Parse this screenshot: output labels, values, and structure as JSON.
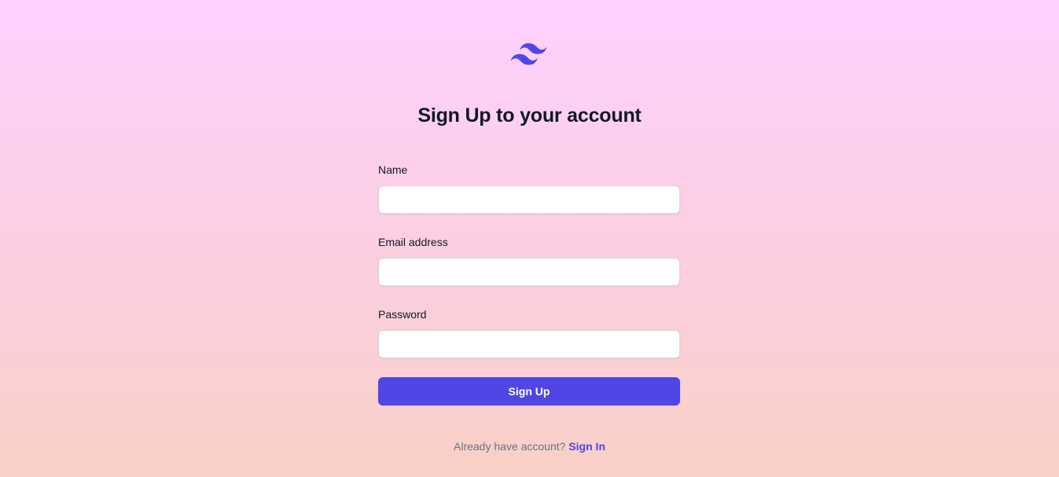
{
  "logo": {
    "icon": "tailwind-waves-icon",
    "color": "#4f46e5"
  },
  "heading": "Sign Up to your account",
  "form": {
    "name": {
      "label": "Name",
      "value": "",
      "placeholder": ""
    },
    "email": {
      "label": "Email address",
      "value": "",
      "placeholder": ""
    },
    "password": {
      "label": "Password",
      "value": "",
      "placeholder": ""
    },
    "submit_label": "Sign Up"
  },
  "footer": {
    "prompt": "Already have account?",
    "link_label": "Sign In"
  },
  "colors": {
    "accent": "#4f46e5",
    "background_top": "#ffd0ff",
    "background_bottom": "#f9d0c6"
  }
}
